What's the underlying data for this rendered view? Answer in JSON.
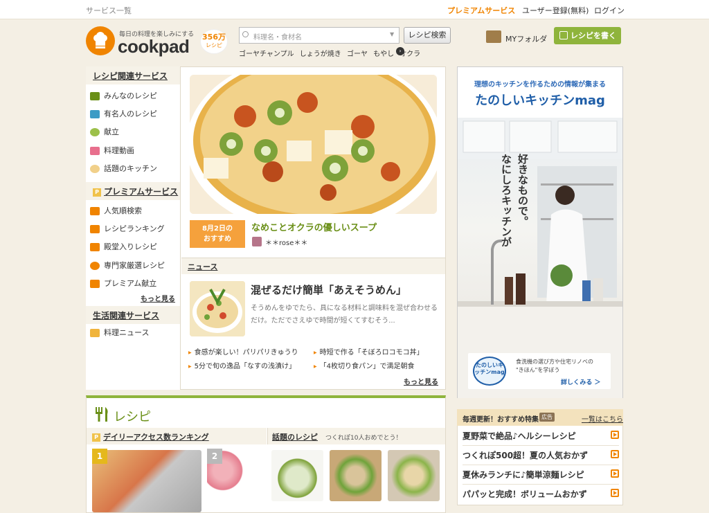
{
  "topbar": {
    "services": "サービス一覧",
    "premium": "プレミアムサービス",
    "register": "ユーザー登録(無料)",
    "login": "ログイン"
  },
  "header": {
    "tagline": "毎日の料理を楽しみにする",
    "logo": "cookpad",
    "recipe_count": "356万",
    "recipe_count_unit": "レシピ",
    "search_placeholder": "料理名・食材名",
    "search_button": "レシピ検索",
    "keywords": [
      "ゴーヤチャンプル",
      "しょうが焼き",
      "ゴーヤ",
      "もやし",
      "オクラ"
    ],
    "my_folder": "MYフォルダ",
    "write_recipe": "レシピを書く"
  },
  "sidebar": {
    "sections": [
      {
        "title": "レシピ関連サービス",
        "items": [
          "みんなのレシピ",
          "有名人のレシピ",
          "献立",
          "料理動画",
          "話題のキッチン"
        ]
      },
      {
        "title": "プレミアムサービス",
        "items": [
          "人気順検索",
          "レシピランキング",
          "殿堂入りレシピ",
          "専門家厳選レシピ",
          "プレミアム献立"
        ],
        "more": "もっと見る"
      },
      {
        "title": "生活関連サービス",
        "items": [
          "料理ニュース"
        ]
      }
    ]
  },
  "featured": {
    "date": "8月2日の",
    "date_label": "おすすめ",
    "title": "なめことオクラの優しいスープ",
    "user": "＊＊rose＊＊"
  },
  "news": {
    "heading": "ニュース",
    "title": "混ぜるだけ簡単「あえそうめん」",
    "description": "そうめんをゆでたら、具になる材料と調味料を混ぜ合わせるだけ。ただでさえゆで時間が短くてすむそう...",
    "links": [
      "食感が楽しい！パリパリきゅうり",
      "時短で作る「そぼろロコモコ丼」",
      "5分で旬の逸品「なすの浅漬け」",
      "「4枚切り食パン」で満足朝食"
    ],
    "more": "もっと見る"
  },
  "ad": {
    "subtitle": "理想のキッチンを作るための情報が集まる",
    "title": "たのしいキッチンmag",
    "vertical_1": "なにしろキッチンが",
    "vertical_2": "好きなもので。",
    "logo_text": "たのしいキッチンmag",
    "desc_line1": "食洗機の選び方や住宅リノベの",
    "desc_line2": "\"きほん\"を学ぼう",
    "more": "詳しくみる ＞"
  },
  "recipe_section": {
    "heading": "レシピ",
    "ranking_heading": "デイリーアクセス数ランキング",
    "rank1": "1",
    "rank2": "2",
    "hot_heading": "話題のレシピ",
    "hot_sub": "つくれぽ10人おめでとう！"
  },
  "features": {
    "heading": "毎週更新！おすすめ特集",
    "ad_label": "広告",
    "more": "一覧はこちら",
    "items": [
      "夏野菜で絶品♪ヘルシーレシピ",
      "つくれぽ500超！夏の人気おかず",
      "夏休みランチに♪簡単涼麺レシピ",
      "パパッと完成！ボリュームおかず"
    ]
  },
  "colors": {
    "brand_orange": "#f08400",
    "accent_green": "#8fb43c",
    "background": "#f4efe4"
  }
}
